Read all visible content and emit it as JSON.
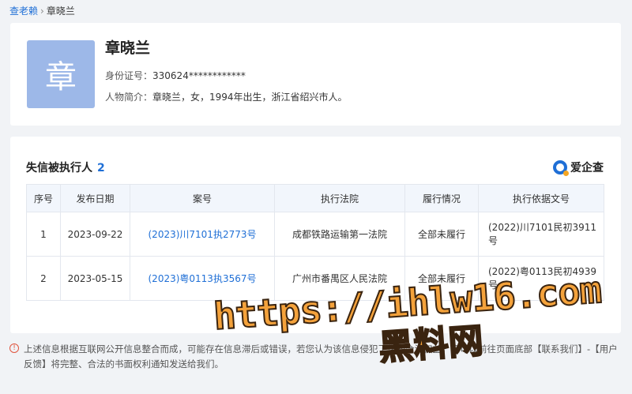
{
  "breadcrumb": {
    "root": "查老赖",
    "current": "章晓兰"
  },
  "person": {
    "avatar_char": "章",
    "name": "章晓兰",
    "id_label": "身份证号：",
    "id_value": "330624************",
    "bio_label": "人物简介：",
    "bio_value": "章晓兰，女，1994年出生，浙江省绍兴市人。"
  },
  "section": {
    "title": "失信被执行人",
    "count": "2",
    "brand": "爱企查"
  },
  "table": {
    "headers": [
      "序号",
      "发布日期",
      "案号",
      "执行法院",
      "履行情况",
      "执行依据文号"
    ],
    "rows": [
      {
        "no": "1",
        "date": "2023-09-22",
        "case": "(2023)川7101执2773号",
        "court": "成都铁路运输第一法院",
        "status": "全部未履行",
        "basis": "(2022)川7101民初3911号"
      },
      {
        "no": "2",
        "date": "2023-05-15",
        "case": "(2023)粤0113执3567号",
        "court": "广州市番禺区人民法院",
        "status": "全部未履行",
        "basis": "(2022)粤0113民初4939号"
      }
    ]
  },
  "footnote": "上述信息根据互联网公开信息整合而成，可能存在信息滞后或错误，若您认为该信息侵犯了您的合法权益，您可以前往页面底部【联系我们】-【用户反馈】将完整、合法的书面权利通知发送给我们。",
  "watermark": {
    "url": "https://ihlw16.com",
    "name": "黑料网"
  },
  "colors": {
    "accent": "#1f6fd6",
    "avatar_bg": "#9db8e8",
    "watermark": "#f4a23b"
  }
}
